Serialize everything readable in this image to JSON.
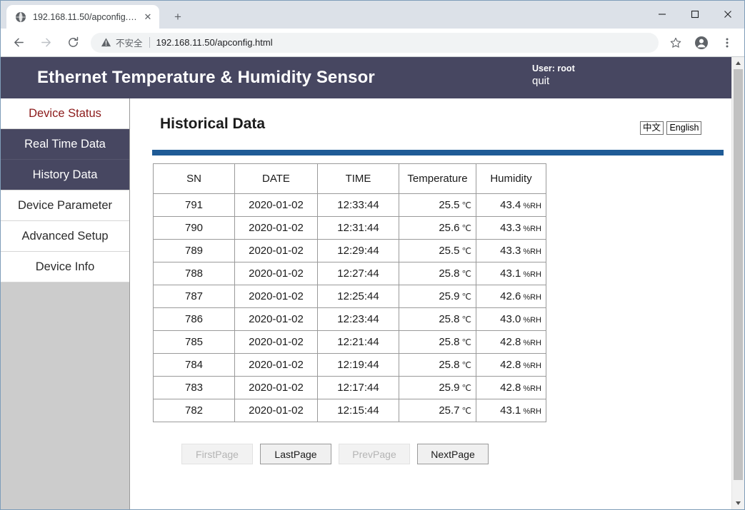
{
  "browser": {
    "tab": {
      "title": "192.168.11.50/apconfig.html",
      "favicon": "globe-icon",
      "close_label": "✕"
    },
    "new_tab_label": "+",
    "window_controls": {
      "minimize": "—",
      "maximize": "□",
      "close": "✕"
    },
    "nav": {
      "back": "←",
      "forward": "→",
      "reload": "⟳"
    },
    "omnibox": {
      "security_label": "不安全",
      "security_icon": "warning-triangle-icon",
      "url": "192.168.11.50/apconfig.html"
    },
    "toolbar_icons": {
      "bookmark": "star-icon",
      "profile": "account-avatar-icon",
      "menu": "three-dot-menu-icon"
    }
  },
  "site": {
    "title": "Ethernet Temperature & Humidity Sensor",
    "user_line": "User: root",
    "quit_label": "quit",
    "lang": {
      "chinese": "中文",
      "english": "English"
    },
    "colors": {
      "header_bg": "#474761",
      "divider": "#1f5b96",
      "sidebar_bg": "#cccccc",
      "accent_text": "#8c1b1b"
    }
  },
  "sidebar": {
    "items": [
      {
        "label": "Device Status",
        "state": "accent"
      },
      {
        "label": "Real Time Data",
        "state": "active"
      },
      {
        "label": "History Data",
        "state": "active"
      },
      {
        "label": "Device Parameter",
        "state": "normal"
      },
      {
        "label": "Advanced Setup",
        "state": "normal"
      },
      {
        "label": "Device Info",
        "state": "normal"
      }
    ]
  },
  "main": {
    "page_title": "Historical Data",
    "table": {
      "headers": [
        "SN",
        "DATE",
        "TIME",
        "Temperature",
        "Humidity"
      ],
      "temp_unit": "℃",
      "hum_unit": "%RH",
      "rows": [
        {
          "sn": "791",
          "date": "2020-01-02",
          "time": "12:33:44",
          "temp": "25.5",
          "hum": "43.4"
        },
        {
          "sn": "790",
          "date": "2020-01-02",
          "time": "12:31:44",
          "temp": "25.6",
          "hum": "43.3"
        },
        {
          "sn": "789",
          "date": "2020-01-02",
          "time": "12:29:44",
          "temp": "25.5",
          "hum": "43.3"
        },
        {
          "sn": "788",
          "date": "2020-01-02",
          "time": "12:27:44",
          "temp": "25.8",
          "hum": "43.1"
        },
        {
          "sn": "787",
          "date": "2020-01-02",
          "time": "12:25:44",
          "temp": "25.9",
          "hum": "42.6"
        },
        {
          "sn": "786",
          "date": "2020-01-02",
          "time": "12:23:44",
          "temp": "25.8",
          "hum": "43.0"
        },
        {
          "sn": "785",
          "date": "2020-01-02",
          "time": "12:21:44",
          "temp": "25.8",
          "hum": "42.8"
        },
        {
          "sn": "784",
          "date": "2020-01-02",
          "time": "12:19:44",
          "temp": "25.8",
          "hum": "42.8"
        },
        {
          "sn": "783",
          "date": "2020-01-02",
          "time": "12:17:44",
          "temp": "25.9",
          "hum": "42.8"
        },
        {
          "sn": "782",
          "date": "2020-01-02",
          "time": "12:15:44",
          "temp": "25.7",
          "hum": "43.1"
        }
      ]
    },
    "pager": [
      {
        "label": "FirstPage",
        "enabled": false
      },
      {
        "label": "LastPage",
        "enabled": true
      },
      {
        "label": "PrevPage",
        "enabled": false
      },
      {
        "label": "NextPage",
        "enabled": true
      }
    ]
  }
}
